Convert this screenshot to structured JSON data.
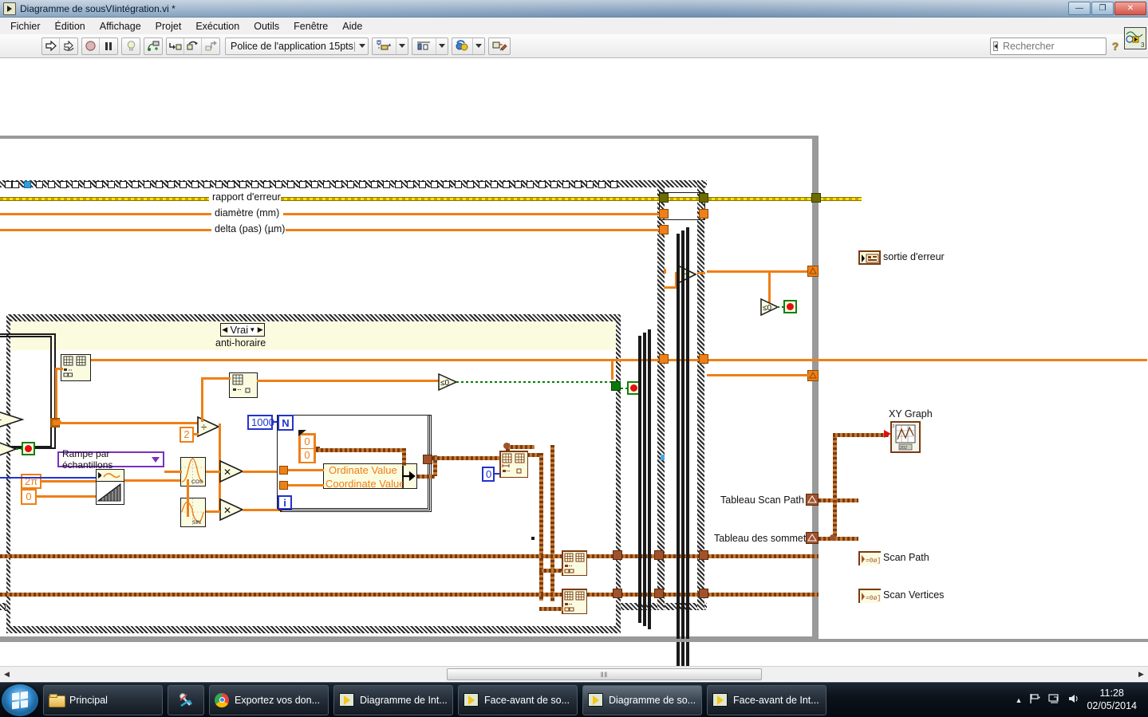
{
  "window": {
    "title": "Diagramme de sousVIintégration.vi *",
    "icon": "labview-vi-icon",
    "buttons": {
      "minimize": "—",
      "maximize": "❐",
      "close": "✕"
    }
  },
  "menu": {
    "items": [
      {
        "label": "Fichier"
      },
      {
        "label": "Édition"
      },
      {
        "label": "Affichage"
      },
      {
        "label": "Projet"
      },
      {
        "label": "Exécution"
      },
      {
        "label": "Outils"
      },
      {
        "label": "Fenêtre"
      },
      {
        "label": "Aide"
      }
    ]
  },
  "toolbar": {
    "run_icon": "run-arrow-icon",
    "run_continuous_icon": "run-continuously-icon",
    "abort_icon": "abort-execution-icon",
    "pause_icon": "pause-icon",
    "highlight_icon": "highlight-execution-bulb-icon",
    "retain_values_icon": "retain-wire-values-icon",
    "step_into_icon": "step-into-icon",
    "step_over_icon": "step-over-icon",
    "step_out_icon": "step-out-icon",
    "font_label": "Police de l'application 15pts",
    "align_icon": "align-objects-icon",
    "distribute_icon": "distribute-objects-icon",
    "reorder_icon": "reorder-objects-icon",
    "cleanup_icon": "cleanup-diagram-icon",
    "help_icon": "context-help-icon",
    "vi_icon": "vi-connector-icon"
  },
  "search": {
    "placeholder": "Rechercher",
    "value": "",
    "icon": "search-magnifier-icon"
  },
  "diagram": {
    "terminal_labels": [
      {
        "label": "rapport d'erreur",
        "wire": "error-cluster"
      },
      {
        "label": "diamètre (mm)",
        "wire": "numeric-orange"
      },
      {
        "label": "delta (pas) (µm)",
        "wire": "numeric-orange"
      }
    ],
    "case_structure": {
      "selector_value": "Vrai",
      "subtitle": "anti-horaire",
      "left_arrow": "◀",
      "right_arrow": "▶",
      "dropdown_arrow": "▼"
    },
    "constants": [
      {
        "name": "two-constant",
        "value": "2",
        "type": "numeric"
      },
      {
        "name": "two-pi-constant",
        "value": "2π",
        "type": "numeric"
      },
      {
        "name": "zero-constant",
        "value": "0",
        "type": "numeric"
      },
      {
        "name": "loop-count-constant",
        "value": "1000",
        "type": "numeric-blue"
      },
      {
        "name": "index-zero-constant",
        "value": "0",
        "type": "numeric-blue"
      },
      {
        "name": "cluster-zero-upper",
        "value": "0",
        "type": "cluster-element"
      },
      {
        "name": "cluster-zero-lower",
        "value": "0",
        "type": "cluster-element"
      }
    ],
    "loop": {
      "count_terminal": "N",
      "iteration_terminal": "i"
    },
    "bundle_labels": [
      {
        "label": "Ordinate Value"
      },
      {
        "label": "Coordinate Value"
      }
    ],
    "ramp_select": {
      "value": "Rampe par échantillons",
      "arrow": "▼"
    },
    "functions": [
      {
        "name": "divide-node",
        "glyph": "÷"
      },
      {
        "name": "multiply-node-cos",
        "glyph": "✕"
      },
      {
        "name": "multiply-node-sin",
        "glyph": "✕"
      },
      {
        "name": "subtract-node",
        "glyph": "−"
      },
      {
        "name": "cosine-node",
        "glyph": "COS"
      },
      {
        "name": "sine-node",
        "glyph": "SIN"
      },
      {
        "name": "less-equal-zero-node-1",
        "glyph": "≤0"
      },
      {
        "name": "less-equal-zero-node-2",
        "glyph": "≤0"
      }
    ],
    "wire_labels": [
      {
        "label": "Tableau Scan Path"
      },
      {
        "label": "Tableau des sommets"
      }
    ],
    "indicators": [
      {
        "label": "sortie d'erreur",
        "kind": "error-cluster-indicator"
      },
      {
        "label": "XY Graph",
        "kind": "xy-graph-indicator"
      },
      {
        "label": "Scan Path",
        "kind": "array-indicator"
      },
      {
        "label": "Scan Vertices",
        "kind": "array-indicator"
      }
    ],
    "colors": {
      "numeric_wire": "#ef7f16",
      "error_wire": "#ffe400",
      "cluster_wire": "#a0522d",
      "boolean_wire": "#008000",
      "node_fill": "#fbfbe0",
      "blue_constant": "#2233cc",
      "ring_border": "#7b2fbf"
    }
  },
  "scrollbar": {
    "left_arrow": "◀",
    "right_arrow": "▶",
    "grip": "‖‖"
  },
  "taskbar": {
    "start": "start-orb",
    "items": [
      {
        "label": "Principal",
        "icon": "folder-icon",
        "active": false,
        "narrow": false
      },
      {
        "label": "",
        "icon": "snipping-tool-icon",
        "active": false,
        "narrow": true
      },
      {
        "label": "Exportez vos don...",
        "icon": "chrome-icon",
        "active": false,
        "narrow": false
      },
      {
        "label": "Diagramme de Int...",
        "icon": "labview-icon",
        "active": false,
        "narrow": false
      },
      {
        "label": "Face-avant de so...",
        "icon": "labview-icon",
        "active": false,
        "narrow": false
      },
      {
        "label": "Diagramme de so...",
        "icon": "labview-icon",
        "active": true,
        "narrow": false
      },
      {
        "label": "Face-avant de Int...",
        "icon": "labview-icon",
        "active": false,
        "narrow": false
      }
    ],
    "tray": {
      "show_hidden": "▲",
      "network_icon": "network-flag-icon",
      "action_center_icon": "action-center-icon",
      "volume_icon": "volume-icon",
      "time": "11:28",
      "date": "02/05/2014"
    }
  }
}
